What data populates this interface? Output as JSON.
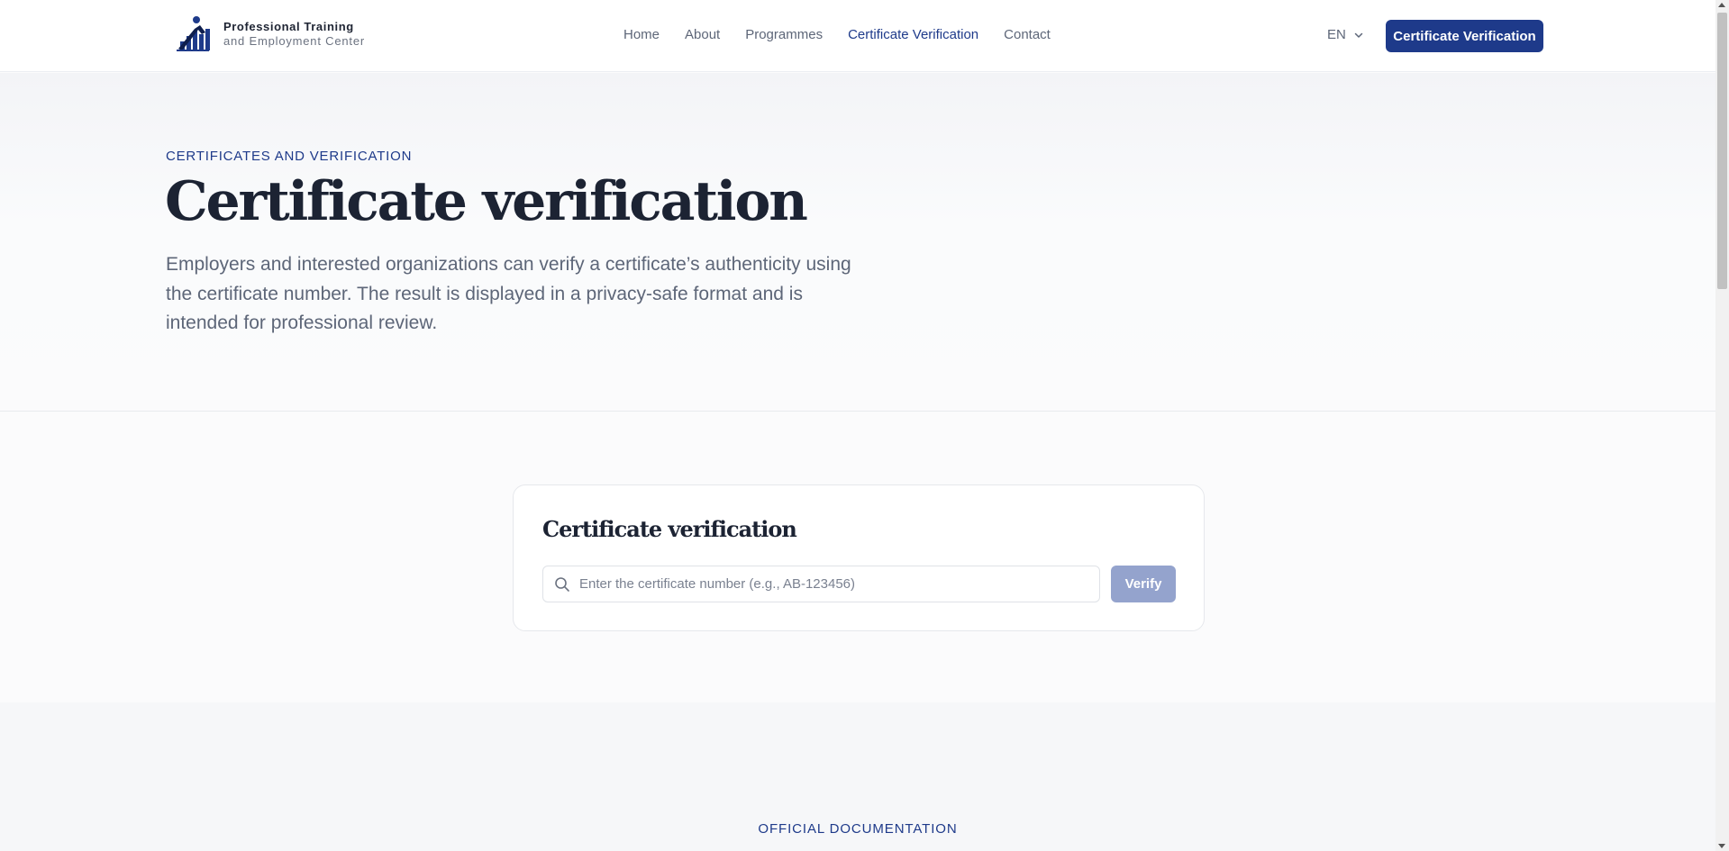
{
  "brand": {
    "line1": "Professional Training",
    "line2": "and Employment Center",
    "logo_icon": "person-chart-logo"
  },
  "nav": {
    "items": [
      {
        "label": "Home",
        "active": false
      },
      {
        "label": "About",
        "active": false
      },
      {
        "label": "Programmes",
        "active": false
      },
      {
        "label": "Certificate Verification",
        "active": true
      },
      {
        "label": "Contact",
        "active": false
      }
    ]
  },
  "language": {
    "selected": "EN",
    "icon": "chevron-down-icon"
  },
  "header_cta": {
    "label": "Certificate Verification"
  },
  "hero": {
    "eyebrow": "CERTIFICATES AND VERIFICATION",
    "title": "Certificate verification",
    "description": "Employers and interested organizations can verify a certificate’s authenticity using the certificate number. The result is displayed in a privacy-safe format and is intended for professional review."
  },
  "verification": {
    "title": "Certificate verification",
    "input_value": "",
    "input_placeholder": "Enter the certificate number (e.g., AB-123456)",
    "search_icon": "search-icon",
    "button_label": "Verify"
  },
  "documentation": {
    "eyebrow": "OFFICIAL DOCUMENTATION"
  },
  "colors": {
    "brand": "#1e3a8a",
    "button_disabled": "#94a3cd",
    "heading": "#1c2333",
    "muted_text": "#5d6678"
  }
}
